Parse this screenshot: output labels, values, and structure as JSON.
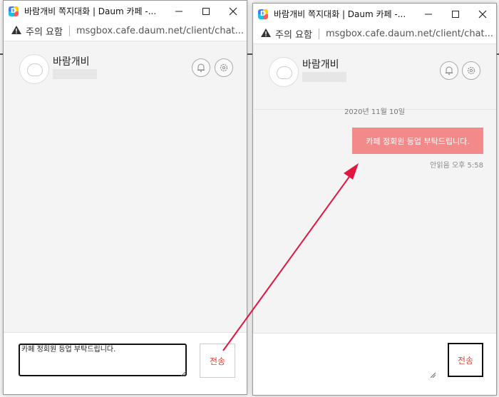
{
  "left_window": {
    "title": "바람개비 쪽지대화 | Daum 카페 -...",
    "addr_warning": "주의 요함",
    "url": "msgbox.cafe.daum.net/client/chat...",
    "contact_name": "바람개비",
    "input_value": "카페 정회원 등업 부탁드립니다.",
    "send_label": "전송"
  },
  "right_window": {
    "title": "바람개비 쪽지대화 | Daum 카페 -...",
    "addr_warning": "주의 요함",
    "url": "msgbox.cafe.daum.net/client/chat...",
    "contact_name": "바람개비",
    "date_label": "2020년 11월 10일",
    "message_text": "카페 정회원 등업 부탁드립니다.",
    "read_status": "안읽음 오후 5:58",
    "input_value": "",
    "send_label": "전송"
  },
  "colors": {
    "bubble": "#f28a8a",
    "send_text": "#e0473a",
    "arrow": "#e3163f"
  },
  "icons": [
    "minimize-icon",
    "maximize-icon",
    "close-icon",
    "warning-icon",
    "bell-icon",
    "settings-icon",
    "resize-grip-icon"
  ]
}
